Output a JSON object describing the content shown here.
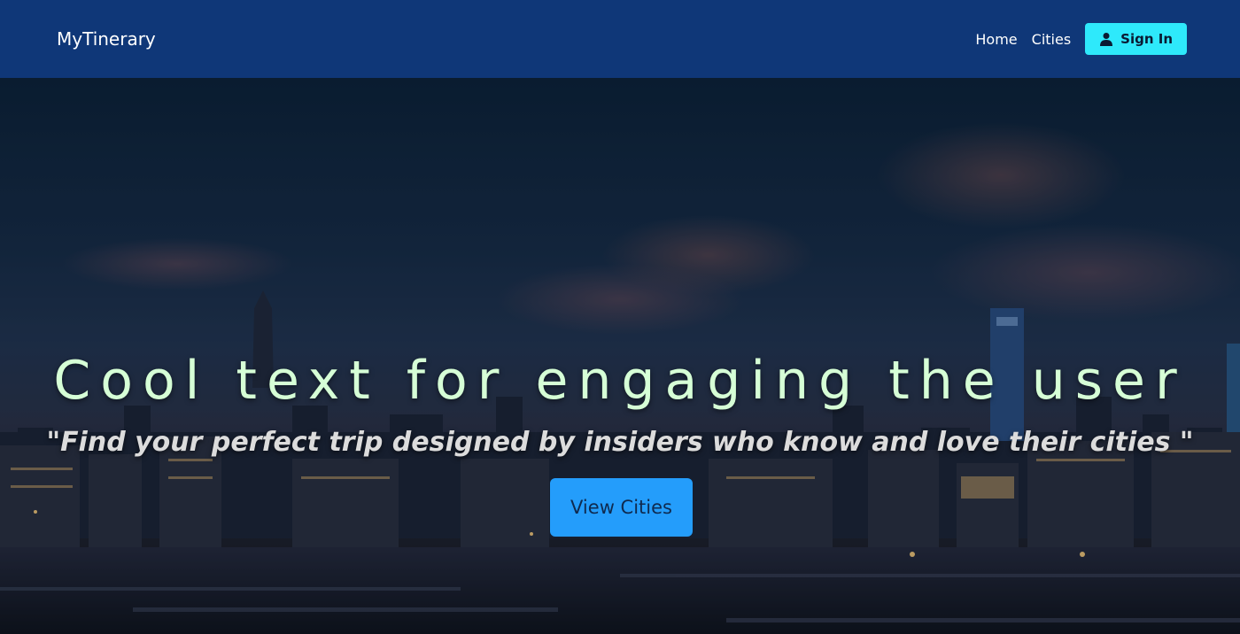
{
  "navbar": {
    "brand": "MyTinerary",
    "links": [
      {
        "label": "Home"
      },
      {
        "label": "Cities"
      }
    ],
    "sign_in_label": "Sign In",
    "sign_in_icon": "user-icon",
    "colors": {
      "background": "#0f3778",
      "sign_in": "#2ee9fb"
    }
  },
  "hero": {
    "headline": "Cool text for engaging the user",
    "tagline": "\"Find your perfect trip designed by insiders who know and love their cities \"",
    "cta_label": "View Cities",
    "colors": {
      "headline": "#d6ffd6",
      "cta": "#249dfb"
    }
  }
}
